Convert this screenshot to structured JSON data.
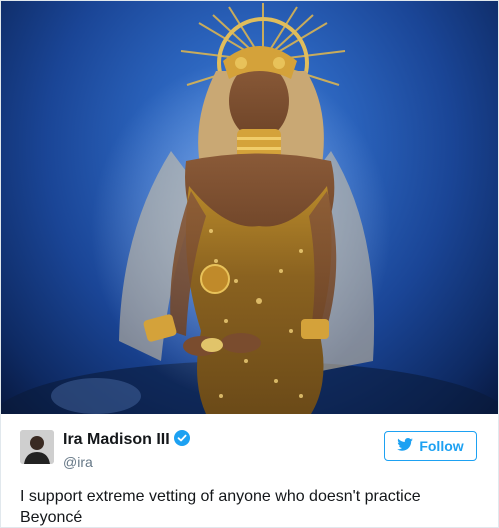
{
  "tweet": {
    "display_name": "Ira Madison III",
    "handle": "@ira",
    "verified_icon": "verified-badge-icon",
    "follow_label": "Follow",
    "follow_icon": "twitter-bird-icon",
    "text_line1": "I support extreme vetting of anyone who doesn't practice",
    "text_line2": "Beyoncé"
  },
  "colors": {
    "twitter_blue": "#1da1f2",
    "text_primary": "#14171a",
    "text_secondary": "#657786",
    "photo_background": "#1f52a8",
    "gold": "#c99a2e"
  }
}
